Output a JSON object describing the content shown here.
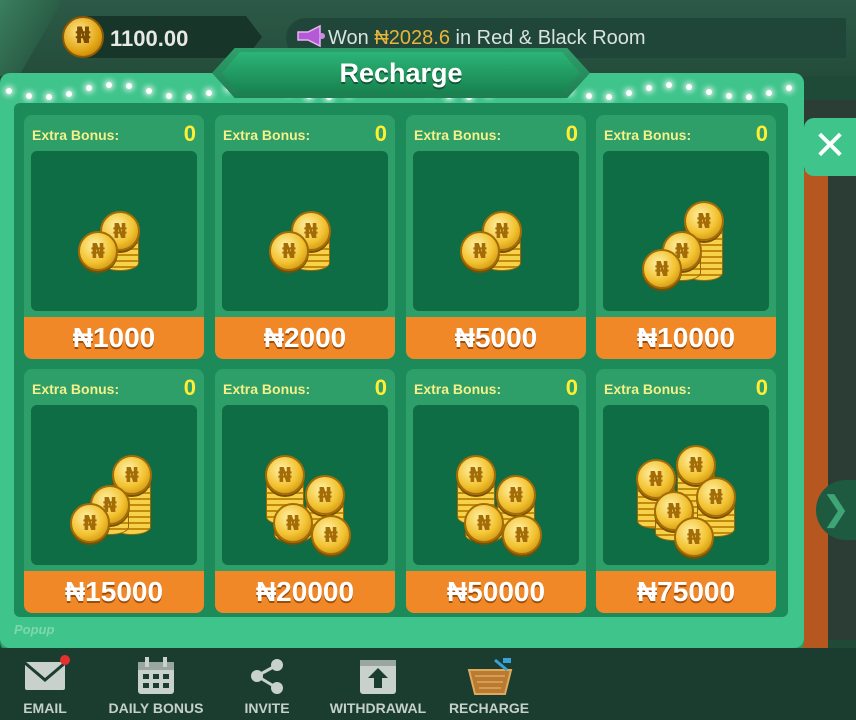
{
  "header": {
    "currency_symbol": "₦",
    "balance": "1100.00",
    "marquee": {
      "prefix": "Won ",
      "amount": "₦2028.6",
      "suffix": " in Red & Black Room"
    }
  },
  "popup": {
    "title": "Recharge",
    "close_symbol": "✕",
    "watermark": "Popup",
    "bonus_label": "Extra Bonus:",
    "cards": [
      {
        "bonus": "0",
        "price": "₦1000",
        "coins": 2
      },
      {
        "bonus": "0",
        "price": "₦2000",
        "coins": 2
      },
      {
        "bonus": "0",
        "price": "₦5000",
        "coins": 2
      },
      {
        "bonus": "0",
        "price": "₦10000",
        "coins": 3
      },
      {
        "bonus": "0",
        "price": "₦15000",
        "coins": 3
      },
      {
        "bonus": "0",
        "price": "₦20000",
        "coins": 4
      },
      {
        "bonus": "0",
        "price": "₦50000",
        "coins": 4
      },
      {
        "bonus": "0",
        "price": "₦75000",
        "coins": 5
      }
    ]
  },
  "bottom_nav": {
    "items": [
      {
        "label": "EMAIL",
        "icon": "mail-icon",
        "has_badge": true
      },
      {
        "label": "DAILY BONUS",
        "icon": "calendar-icon"
      },
      {
        "label": "INVITE",
        "icon": "share-icon"
      },
      {
        "label": "WITHDRAWAL",
        "icon": "withdraw-icon"
      },
      {
        "label": "RECHARGE",
        "icon": "basket-icon"
      }
    ]
  },
  "colors": {
    "popup_bg": "#3fc48c",
    "card_bg": "#2e9f69",
    "card_art": "#0e6d45",
    "price_bar": "#f08828",
    "bonus_value": "#ffee33",
    "gold": "#e7b53c"
  }
}
